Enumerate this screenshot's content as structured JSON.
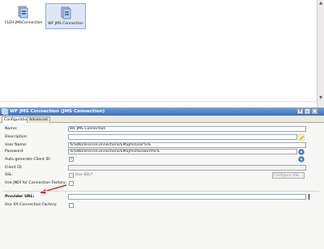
{
  "canvas": {
    "resources": [
      {
        "label": "CLEH JMSConnection",
        "selected": false
      },
      {
        "label": "WF JMS Connection",
        "selected": true
      }
    ]
  },
  "panel": {
    "title": "WF JMS Connection (JMS Connection)",
    "tabs": [
      "Configuration",
      "Advanced"
    ],
    "active_tab": "Configuration"
  },
  "form": {
    "name_label": "Name:",
    "name_value": "WF JMS Connection",
    "description_label": "Description:",
    "description_value": "",
    "username_label": "User Name:",
    "username_value": "%%WorkForceConnections/EMSJmsUser%%",
    "password_label": "Password:",
    "password_value": "%%WorkForceConnections/EMSJmsPassword%%",
    "autogen_label": "Auto-generate Client ID:",
    "autogen_checked": true,
    "clientid_label": "Client ID:",
    "clientid_value": "",
    "ssl_label": "SSL:",
    "use_ssl_label": "Use SSL?",
    "configure_ssl_label": "Configure SSL...",
    "jndi_label": "Use JNDI for Connection Factory:",
    "provider_url_label": "Provider URL:",
    "provider_url_value": "",
    "xa_label": "Use XA Connection Factory:"
  },
  "colors": {
    "title_bar": "#3f6fb8",
    "annotation_arrow": "#cc1111"
  }
}
